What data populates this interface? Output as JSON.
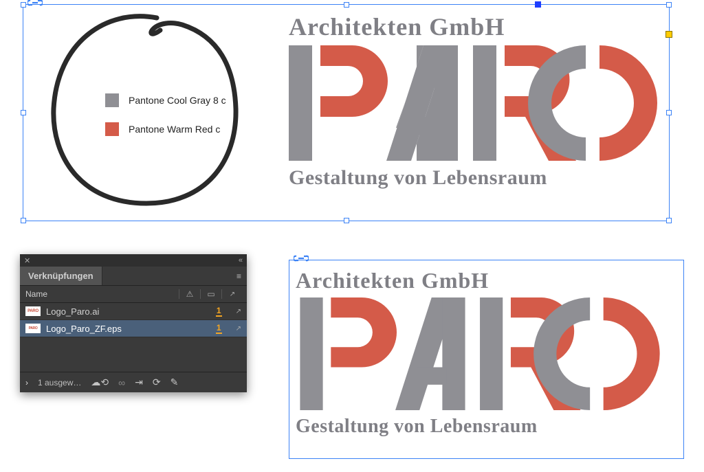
{
  "legend": {
    "gray_label": "Pantone Cool Gray 8 c",
    "red_label": "Pantone Warm Red c"
  },
  "logo": {
    "line1": "Architekten GmbH",
    "line2": "Gestaltung von Lebensraum"
  },
  "colors": {
    "gray": "#8f8f94",
    "red": "#d45b49"
  },
  "links_panel": {
    "tab_title": "Verknüpfungen",
    "col_name": "Name",
    "rows": [
      {
        "thumb": "PARO",
        "name": "Logo_Paro.ai",
        "count": "1"
      },
      {
        "thumb": "PARO",
        "name": "Logo_Paro_ZF.eps",
        "count": "1"
      }
    ],
    "footer_status": "1 ausgew…"
  }
}
